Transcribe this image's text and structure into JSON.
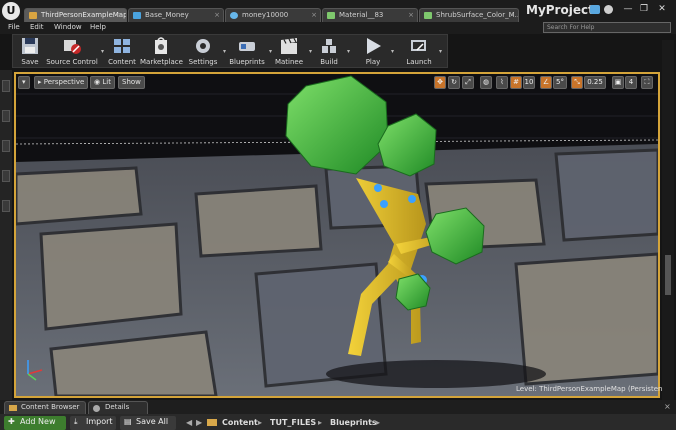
{
  "editor": {
    "logo": "U",
    "project_name": "MyProject",
    "tabs": [
      {
        "label": "ThirdPersonExampleMap",
        "active": true,
        "icon": "map-icon",
        "color": "#d9a441"
      },
      {
        "label": "Base_Money",
        "active": false,
        "icon": "blueprint-icon",
        "color": "#4aa3df"
      },
      {
        "label": "money10000",
        "active": false,
        "icon": "mesh-icon",
        "color": "#67b7ea"
      },
      {
        "label": "Material__83",
        "active": false,
        "icon": "material-icon",
        "color": "#7ec86d"
      },
      {
        "label": "ShrubSurface_Color_M...",
        "active": false,
        "icon": "material-icon",
        "color": "#7ec86d"
      }
    ],
    "window_controls": [
      "—",
      "❐",
      "✕"
    ]
  },
  "menu": {
    "items": [
      "File",
      "Edit",
      "Window",
      "Help"
    ],
    "search_placeholder": "Search For Help"
  },
  "toolbar": {
    "buttons": [
      {
        "label": "Save",
        "icon": "save-icon"
      },
      {
        "label": "Source Control",
        "icon": "source-control-icon"
      },
      {
        "label": "Content",
        "icon": "content-icon"
      },
      {
        "label": "Marketplace",
        "icon": "marketplace-icon"
      },
      {
        "label": "Settings",
        "icon": "settings-icon"
      },
      {
        "label": "Blueprints",
        "icon": "blueprints-icon"
      },
      {
        "label": "Matinee",
        "icon": "matinee-icon"
      },
      {
        "label": "Build",
        "icon": "build-icon"
      },
      {
        "label": "Play",
        "icon": "play-icon"
      },
      {
        "label": "Launch",
        "icon": "launch-icon"
      }
    ]
  },
  "viewport": {
    "view_mode": "Perspective",
    "lighting": "Lit",
    "show": "Show",
    "grid_snap": "10",
    "rotation_snap": "5°",
    "scale_snap": "0.25",
    "camera_speed": "4",
    "level_label": "Level:",
    "level_name": "ThirdPersonExampleMap (Persistent)",
    "accent_color": "#d4a43a"
  },
  "content_browser": {
    "tabs": [
      "Content Browser",
      "Details"
    ],
    "add_new": "Add New",
    "import": "Import",
    "save_all": "Save All",
    "breadcrumb": [
      "Content",
      "TUT_FILES",
      "Blueprints"
    ]
  }
}
